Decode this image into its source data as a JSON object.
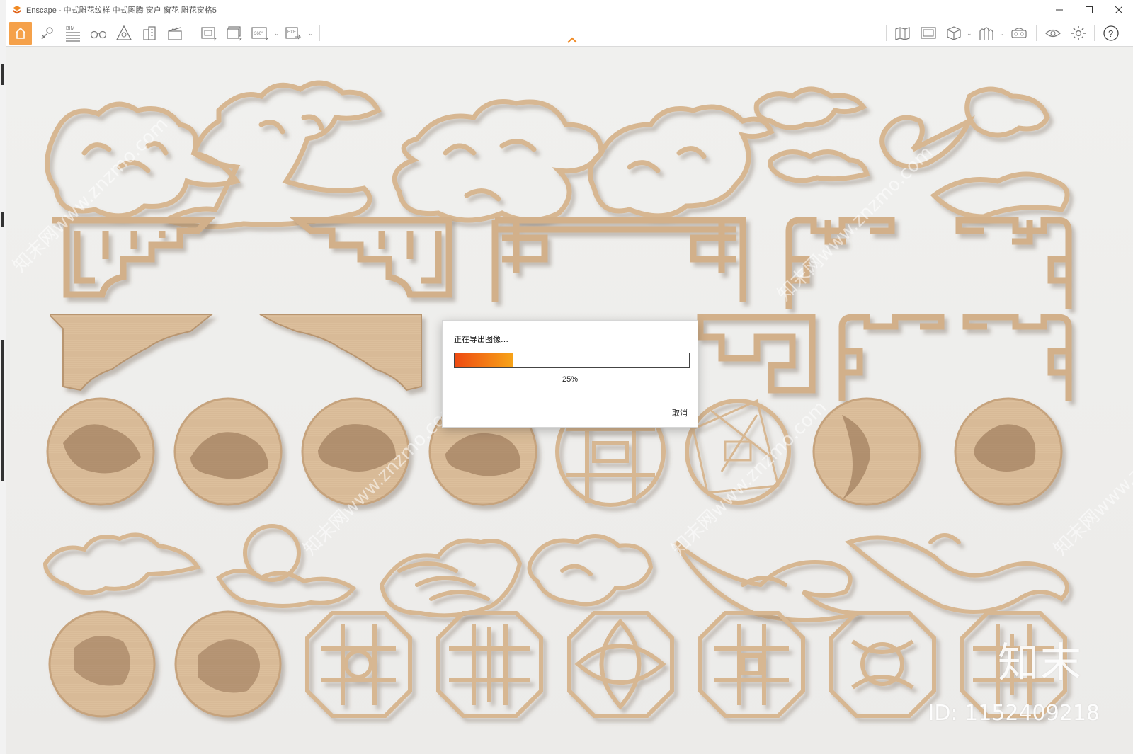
{
  "window": {
    "title": "Enscape - 中式雕花纹样 中式图腾 窗户 窗花 雕花窗格5",
    "controls": [
      "minimize-icon",
      "maximize-icon",
      "close-icon"
    ]
  },
  "toolbar": {
    "left_tools": [
      "home-icon",
      "location-icon",
      "bim-icon",
      "binoculars-icon",
      "assets-icon",
      "buildings-icon",
      "clapperboard-icon",
      "screenshot-icon",
      "batch-render-icon",
      "panorama-360-icon",
      "exe-export-icon"
    ],
    "bim_label": "BIM",
    "pano_label": "360°",
    "exe_label": "EXE",
    "right_tools": [
      "map-icon",
      "media-icon",
      "cube-icon",
      "material-icon",
      "vr-headset-icon",
      "eye-icon",
      "settings-icon",
      "help-icon"
    ],
    "help_label": "?"
  },
  "dialog": {
    "title": "正在导出图像…",
    "progress": 0.25,
    "progress_text": "25%",
    "cancel_label": "取消"
  },
  "watermark": {
    "logo_text": "知末",
    "id_text": "ID: 1152409218",
    "diagonal_text": "知末网www.znzmo.com"
  },
  "colors": {
    "accent": "#f5a14a",
    "wood": "#d9b995",
    "wood_dark": "#b48f69",
    "progress_start": "#ee4a12",
    "progress_end": "#f7a418"
  }
}
